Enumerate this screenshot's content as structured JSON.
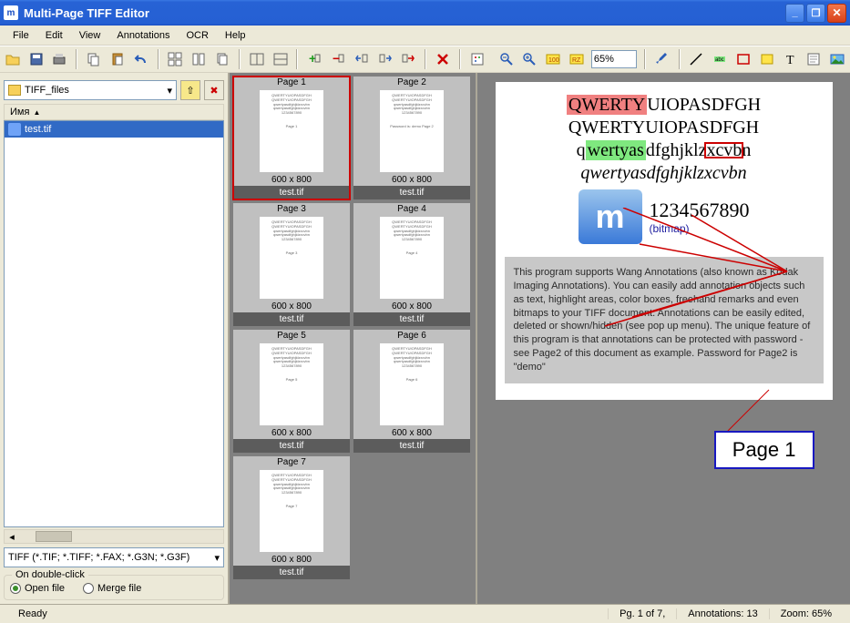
{
  "app": {
    "title": "Multi-Page TIFF Editor"
  },
  "menus": [
    "File",
    "Edit",
    "View",
    "Annotations",
    "OCR",
    "Help"
  ],
  "zoom": "65%",
  "folder": "TIFF_files",
  "file_header": "Имя",
  "files": [
    {
      "name": "test.tif",
      "selected": true
    }
  ],
  "filetype_filter": "TIFF (*.TIF; *.TIFF; *.FAX; *.G3N; *.G3F)",
  "on_dblclick": {
    "legend": "On double-click",
    "open": "Open file",
    "merge": "Merge file"
  },
  "thumbs": [
    {
      "title": "Page 1",
      "dims": "600 x 800",
      "file": "test.tif",
      "selected": true,
      "preview": "QWERTYUIOPASDFGH\nQWERTYUIOPASDFGH\nqwertyasdfghjklzxcvbn\nqwertyasdfghjklzxcvbn\n1234567890",
      "footer": "Page 1"
    },
    {
      "title": "Page 2",
      "dims": "600 x 800",
      "file": "test.tif",
      "preview": "QWERTYUIOPASDFGH\nQWERTYUIOPASDFGH\nqwertyasdfghjklzxcvbn\nqwertyasdfghjklzxcvbn\n1234567890",
      "footer": "Password is: demo\nPage 2"
    },
    {
      "title": "Page 3",
      "dims": "600 x 800",
      "file": "test.tif",
      "preview": "QWERTYUIOPASDFGH\nQWERTYUIOPASDFGH\nqwertyasdfghjklzxcvbn\nqwertyasdfghjklzxcvbn\n1234567890",
      "footer": "Page 3"
    },
    {
      "title": "Page 4",
      "dims": "600 x 800",
      "file": "test.tif",
      "preview": "QWERTYUIOPASDFGH\nQWERTYUIOPASDFGH\nqwertyasdfghjklzxcvbn\nqwertyasdfghjklzxcvbn\n1234567890",
      "footer": "Page 4"
    },
    {
      "title": "Page 5",
      "dims": "600 x 800",
      "file": "test.tif",
      "preview": "QWERTYUIOPASDFGH\nQWERTYUIOPASDFGH\nqwertyasdfghjklzxcvbn\nqwertyasdfghjklzxcvbn\n1234567890",
      "footer": "Page 5"
    },
    {
      "title": "Page 6",
      "dims": "600 x 800",
      "file": "test.tif",
      "preview": "QWERTYUIOPASDFGH\nQWERTYUIOPASDFGH\nqwertyasdfghjklzxcvbn\nqwertyasdfghjklzxcvbn\n1234567890",
      "footer": "Page 6"
    },
    {
      "title": "Page 7",
      "dims": "600 x 800",
      "file": "test.tif",
      "preview": "QWERTYUIOPASDFGH\nQWERTYUIOPASDFGH\nqwertyasdfghjklzxcvbn\nqwertyasdfghjklzxcvbn\n1234567890",
      "footer": "Page 7"
    }
  ],
  "document": {
    "line1_a": "QWERTY",
    "line1_b": "UIOPASDFGH",
    "line2": "QWERTYUIOPASDFGH",
    "line3_a": "q",
    "line3_b": "wertyas",
    "line3_c": "dfghjklz",
    "line3_d": "xcvb",
    "line3_e": "n",
    "line4": "qwertyasdfghjklzxcvbn",
    "numbers": "1234567890",
    "bitmap_label": "(bitmap)",
    "annotation_text": "This program supports Wang Annotations (also known as Kodak Imaging Annotations). You can easily add annotation objects such as text, highlight areas, color boxes, freehand remarks and even bitmaps to your TIFF document. Annotations can be easily edited, deleted or shown/hidden (see pop up menu). The unique feature of this program is that annotations can be protected with password - see Page2 of this document as example. Password for Page2 is \"demo\"",
    "page_badge": "Page 1"
  },
  "status": {
    "ready": "Ready",
    "page": "Pg. 1 of 7,",
    "annots": "Annotations: 13",
    "zoom": "Zoom: 65%"
  }
}
